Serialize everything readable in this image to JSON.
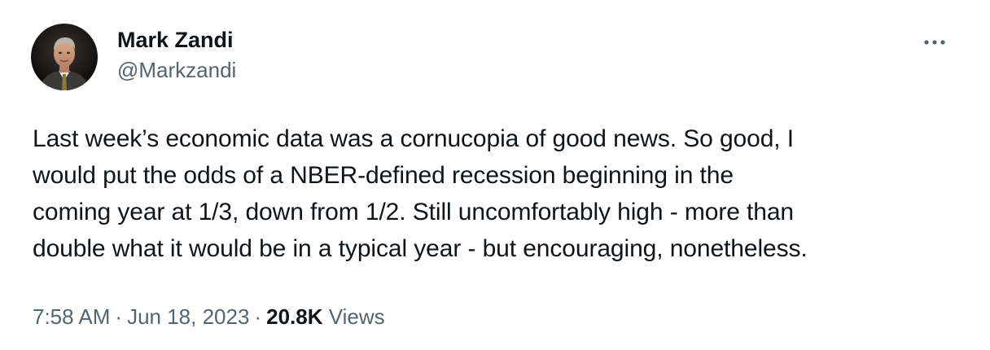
{
  "author": {
    "name": "Mark Zandi",
    "handle": "@Markzandi"
  },
  "more_icon": "ellipsis-icon",
  "tweet": {
    "lines": [
      "Last week’s economic data was a cornucopia of good news. So good, I",
      "would put the odds of a NBER-defined recession beginning in the",
      "coming year at 1/3, down from 1/2. Still uncomfortably high - more than",
      "double what it would be in a typical year - but encouraging, nonetheless."
    ]
  },
  "meta": {
    "time": "7:58 AM",
    "separator": "·",
    "date": "Jun 18, 2023",
    "views_count": "20.8K",
    "views_label": "Views"
  },
  "colors": {
    "text_primary": "#0f1419",
    "text_secondary": "#536471",
    "background": "#ffffff"
  }
}
